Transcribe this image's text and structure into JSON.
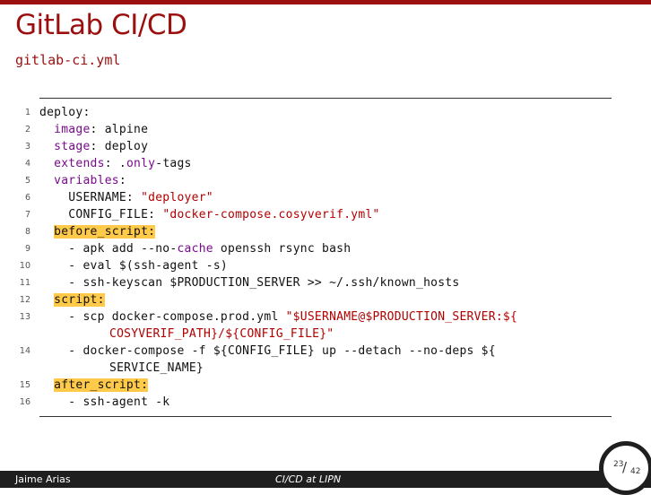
{
  "slide": {
    "title": "GitLab CI/CD",
    "subtitle": "gitlab-ci.yml"
  },
  "code": {
    "lines": [
      {
        "n": "1",
        "p": [
          "deploy:"
        ]
      },
      {
        "n": "2",
        "p": [
          "  ",
          "image",
          ": alpine"
        ]
      },
      {
        "n": "3",
        "p": [
          "  ",
          "stage",
          ": deploy"
        ]
      },
      {
        "n": "4",
        "p": [
          "  ",
          "extends",
          ": .",
          "only",
          "-tags"
        ]
      },
      {
        "n": "5",
        "p": [
          "  ",
          "variables",
          ":"
        ]
      },
      {
        "n": "6",
        "p": [
          "    USERNAME: ",
          "\"deployer\""
        ]
      },
      {
        "n": "7",
        "p": [
          "    CONFIG_FILE: ",
          "\"docker-compose.cosyverif.yml\""
        ]
      },
      {
        "n": "8",
        "p": [
          "  ",
          "before_script:"
        ]
      },
      {
        "n": "9",
        "p": [
          "    - apk add --no-",
          "cache",
          " openssh rsync bash"
        ]
      },
      {
        "n": "10",
        "p": [
          "    - eval $(ssh-agent -s)"
        ]
      },
      {
        "n": "11",
        "p": [
          "    - ssh-keyscan $PRODUCTION_SERVER >> ~/.ssh/known_hosts"
        ]
      },
      {
        "n": "12",
        "p": [
          "  ",
          "script:"
        ]
      },
      {
        "n": "13",
        "p": [
          "    - scp docker-compose.prod.yml ",
          "\"$USERNAME@$PRODUCTION_SERVER:${"
        ],
        "c": "COSYVERIF_PATH}/${CONFIG_FILE}\""
      },
      {
        "n": "14",
        "p": [
          "    - docker-compose -f ${CONFIG_FILE} up --detach --no-deps ${"
        ],
        "c": "SERVICE_NAME}"
      },
      {
        "n": "15",
        "p": [
          "  ",
          "after_script:"
        ]
      },
      {
        "n": "16",
        "p": [
          "    - ssh-agent -k"
        ]
      }
    ]
  },
  "footer": {
    "author": "Jaime Arias",
    "title": "CI/CD at LIPN",
    "page_current": "23",
    "page_sep": "/",
    "page_total": "42"
  },
  "colors": {
    "accent": "#9b0f0f",
    "keyword": "#7a0a8f",
    "string": "#b20000",
    "highlight": "#ffc94a",
    "footer_bg": "#1f1f1f"
  }
}
